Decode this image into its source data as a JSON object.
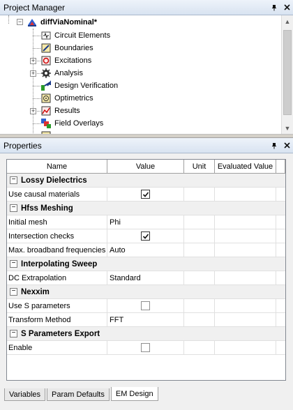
{
  "project_manager": {
    "title": "Project Manager",
    "pin_glyph": "📌",
    "close_glyph": "✕",
    "tree": {
      "root_label": "diffViaNominal*",
      "items": [
        {
          "label": "Circuit Elements",
          "icon": "circuit-elements-icon",
          "expander": ""
        },
        {
          "label": "Boundaries",
          "icon": "boundaries-icon",
          "expander": ""
        },
        {
          "label": "Excitations",
          "icon": "excitations-icon",
          "expander": "+"
        },
        {
          "label": "Analysis",
          "icon": "analysis-icon",
          "expander": "+"
        },
        {
          "label": "Design Verification",
          "icon": "design-verification-icon",
          "expander": ""
        },
        {
          "label": "Optimetrics",
          "icon": "optimetrics-icon",
          "expander": ""
        },
        {
          "label": "Results",
          "icon": "results-icon",
          "expander": "+"
        },
        {
          "label": "Field Overlays",
          "icon": "field-overlays-icon",
          "expander": ""
        }
      ]
    }
  },
  "properties": {
    "title": "Properties",
    "columns": [
      "Name",
      "Value",
      "Unit",
      "Evaluated Value"
    ],
    "categories": [
      {
        "label": "Lossy Dielectrics",
        "rows": [
          {
            "name": "Use causal materials",
            "type": "checkbox",
            "checked": true
          }
        ]
      },
      {
        "label": "Hfss Meshing",
        "rows": [
          {
            "name": "Initial mesh",
            "type": "text",
            "value": "Phi"
          },
          {
            "name": "Intersection checks",
            "type": "checkbox",
            "checked": true
          },
          {
            "name": "Max. broadband frequencies",
            "type": "text",
            "value": "Auto"
          }
        ]
      },
      {
        "label": "Interpolating Sweep",
        "rows": [
          {
            "name": "DC Extrapolation",
            "type": "text",
            "value": "Standard"
          }
        ]
      },
      {
        "label": "Nexxim",
        "rows": [
          {
            "name": "Use S parameters",
            "type": "checkbox",
            "checked": false
          },
          {
            "name": "Transform Method",
            "type": "text",
            "value": "FFT"
          }
        ]
      },
      {
        "label": "S Parameters Export",
        "rows": [
          {
            "name": "Enable",
            "type": "checkbox",
            "checked": false
          }
        ]
      }
    ],
    "tabs": [
      {
        "label": "Variables",
        "active": false
      },
      {
        "label": "Param Defaults",
        "active": false
      },
      {
        "label": "EM Design",
        "active": true
      }
    ]
  },
  "colors": {
    "title_bar": "#dbe5f1",
    "category_bg": "#f0f0f0",
    "grid_border": "#828790"
  }
}
